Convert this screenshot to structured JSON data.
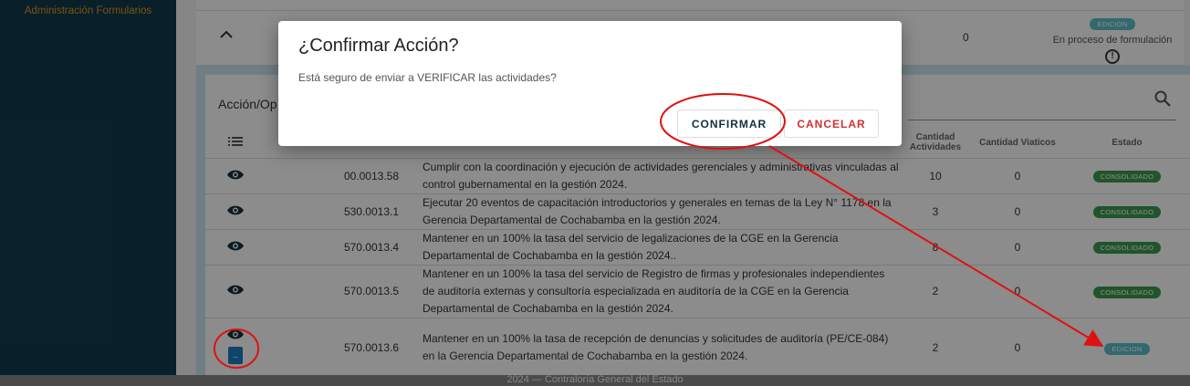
{
  "sidebar": {
    "items": [
      {
        "label": "Administración Formularios"
      }
    ]
  },
  "top_row": {
    "value": "0",
    "estado_badge": "EDICION",
    "estado_text": "En proceso de formulación"
  },
  "section": {
    "title": "Acción/Op",
    "table": {
      "headers": {
        "cantidad_actividades": "Cantidad Actividades",
        "cantidad_viaticos": "Cantidad Viaticos",
        "estado": "Estado"
      },
      "rows": [
        {
          "code": "00.0013.58",
          "desc": "Cumplir con la coordinación y ejecución de actividades gerenciales y administrativas vinculadas al control gubernamental en la gestión 2024.",
          "actividades": "10",
          "viaticos": "0",
          "estado": "CONSOLIDADO"
        },
        {
          "code": "530.0013.1",
          "desc": "Ejecutar 20 eventos de capacitación introductorios y generales en temas de la Ley N° 1178 en la Gerencia Departamental de Cochabamba en la gestión 2024.",
          "actividades": "3",
          "viaticos": "0",
          "estado": "CONSOLIDADO"
        },
        {
          "code": "570.0013.4",
          "desc": "Mantener en un 100% la tasa del servicio de legalizaciones de la CGE en la Gerencia Departamental de Cochabamba en la gestión 2024..",
          "actividades": "8",
          "viaticos": "0",
          "estado": "CONSOLIDADO"
        },
        {
          "code": "570.0013.5",
          "desc": "Mantener en un 100% la tasa del servicio de Registro de firmas y profesionales independientes de auditoría externas y consultoría especializada en auditoría de la CGE en la Gerencia Departamental de Cochabamba en la gestión 2024.",
          "actividades": "2",
          "viaticos": "0",
          "estado": "CONSOLIDADO"
        },
        {
          "code": "570.0013.6",
          "desc": "Mantener en un 100% la tasa de recepción de denuncias y solicitudes de auditoría (PE/CE-084) en la Gerencia Departamental de Cochabamba en la gestión 2024.",
          "actividades": "2",
          "viaticos": "0",
          "estado": "EDICION"
        }
      ]
    }
  },
  "dialog": {
    "title": "¿Confirmar Acción?",
    "message": "Está seguro de enviar a VERIFICAR las actividades?",
    "confirm_label": "CONFIRMAR",
    "cancel_label": "CANCELAR"
  },
  "footer": {
    "text": "2024 — Contraloría General del Estado"
  },
  "colors": {
    "sidebar_bg": "#123a4c",
    "accent": "#d99a1c",
    "consolidado": "#3d9a4e",
    "edicion": "#5bc0c8",
    "annotation": "#e01010"
  }
}
